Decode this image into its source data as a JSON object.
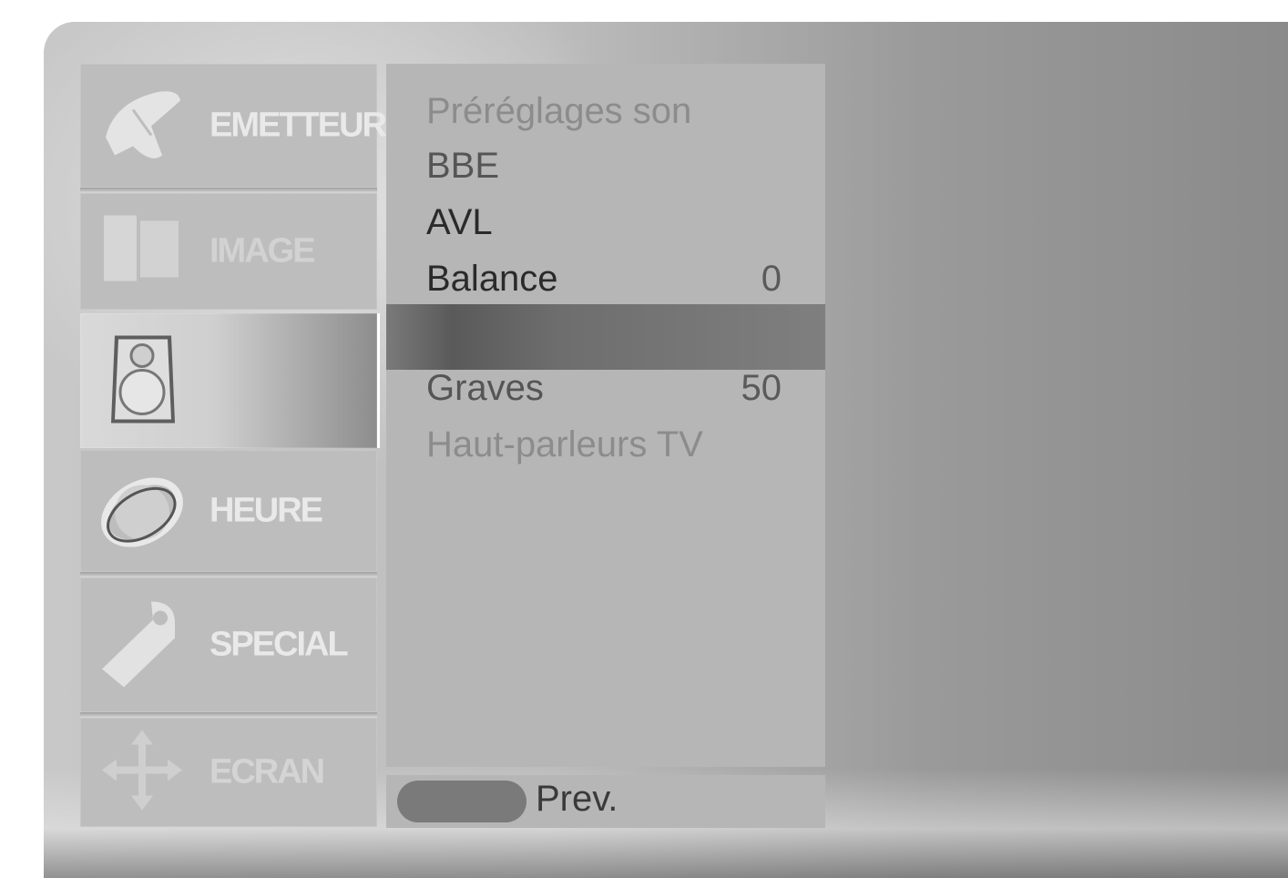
{
  "menu": {
    "items": [
      {
        "label": "EMETTEUR",
        "icon": "satellite-dish-icon"
      },
      {
        "label": "IMAGE",
        "icon": "picture-frames-icon"
      },
      {
        "label": "",
        "icon": "speaker-icon"
      },
      {
        "label": "HEURE",
        "icon": "orbit-icon"
      },
      {
        "label": "SPECIAL",
        "icon": "tag-icon"
      },
      {
        "label": "ECRAN",
        "icon": "move-arrows-icon"
      }
    ]
  },
  "panel": {
    "rows": [
      {
        "label": "Préréglages son",
        "value": ""
      },
      {
        "label": "BBE",
        "value": ""
      },
      {
        "label": "AVL",
        "value": ""
      },
      {
        "label": "Balance",
        "value": "0"
      },
      {
        "label": "Graves",
        "value": "50"
      },
      {
        "label": "Haut-parleurs TV",
        "value": ""
      }
    ]
  },
  "footer": {
    "prev_label": "Prev."
  }
}
